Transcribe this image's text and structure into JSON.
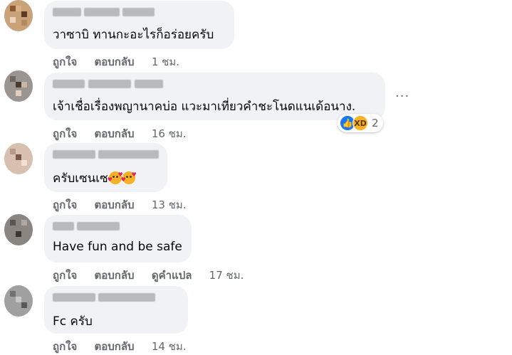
{
  "comments": [
    {
      "text": "วาซาบิ ทานกะอะไรก็อร่อยครับ",
      "actions": {
        "like": "ถูกใจ",
        "reply": "ตอบกลับ",
        "time": "1 ชม."
      }
    },
    {
      "text": "เจ้าเชื่อเรื่องพญานาคบ่อ แวะมาเที่ยวคำชะโนดแนเด้อนาง.",
      "actions": {
        "like": "ถูกใจ",
        "reply": "ตอบกลับ",
        "time": "16 ชม."
      },
      "reactions": {
        "icons": [
          "like-icon",
          "haha-icon"
        ],
        "count": "2"
      },
      "more_icon": "more-options-icon"
    },
    {
      "text": "ครับเซนเซ",
      "emojis": [
        "smiling-face-with-hearts-icon",
        "smiling-face-with-hearts-icon"
      ],
      "actions": {
        "like": "ถูกใจ",
        "reply": "ตอบกลับ",
        "time": "13 ชม."
      }
    },
    {
      "text": "Have fun and be safe",
      "actions": {
        "like": "ถูกใจ",
        "reply": "ตอบกลับ",
        "translate": "ดูคำแปล",
        "time": "17 ชม."
      }
    },
    {
      "text": "Fc ครับ",
      "actions": {
        "like": "ถูกใจ",
        "reply": "ตอบกลับ",
        "time": "14 ชม."
      }
    }
  ],
  "colors": {
    "bubble": "#f0f2f5",
    "secondary_text": "#65676b",
    "like_blue": "#1877f2"
  }
}
